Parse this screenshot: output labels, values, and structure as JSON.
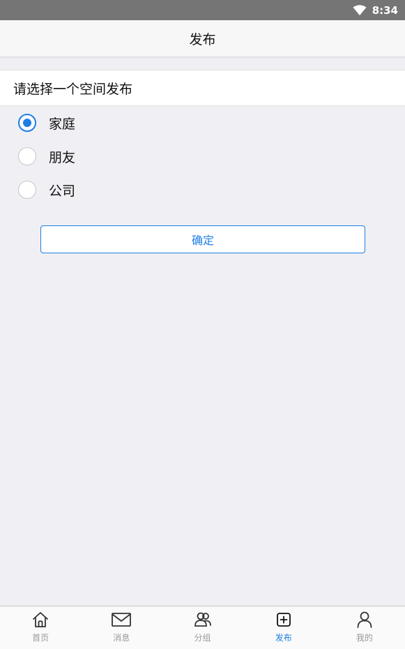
{
  "status_bar": {
    "time": "8:34",
    "wifi_icon": "wifi-icon"
  },
  "nav": {
    "title": "发布"
  },
  "prompt": "请选择一个空间发布",
  "radio_options": [
    {
      "label": "家庭",
      "checked": true
    },
    {
      "label": "朋友",
      "checked": false
    },
    {
      "label": "公司",
      "checked": false
    }
  ],
  "confirm_label": "确定",
  "tabs": [
    {
      "label": "首页",
      "icon": "home-icon",
      "active": false
    },
    {
      "label": "消息",
      "icon": "mail-icon",
      "active": false
    },
    {
      "label": "分组",
      "icon": "group-icon",
      "active": false
    },
    {
      "label": "发布",
      "icon": "add-square-icon",
      "active": true
    },
    {
      "label": "我的",
      "icon": "person-icon",
      "active": false
    }
  ],
  "colors": {
    "accent": "#1e7ee6",
    "background": "#efeff4",
    "status_bar": "#757575",
    "tab_inactive": "#999999"
  }
}
